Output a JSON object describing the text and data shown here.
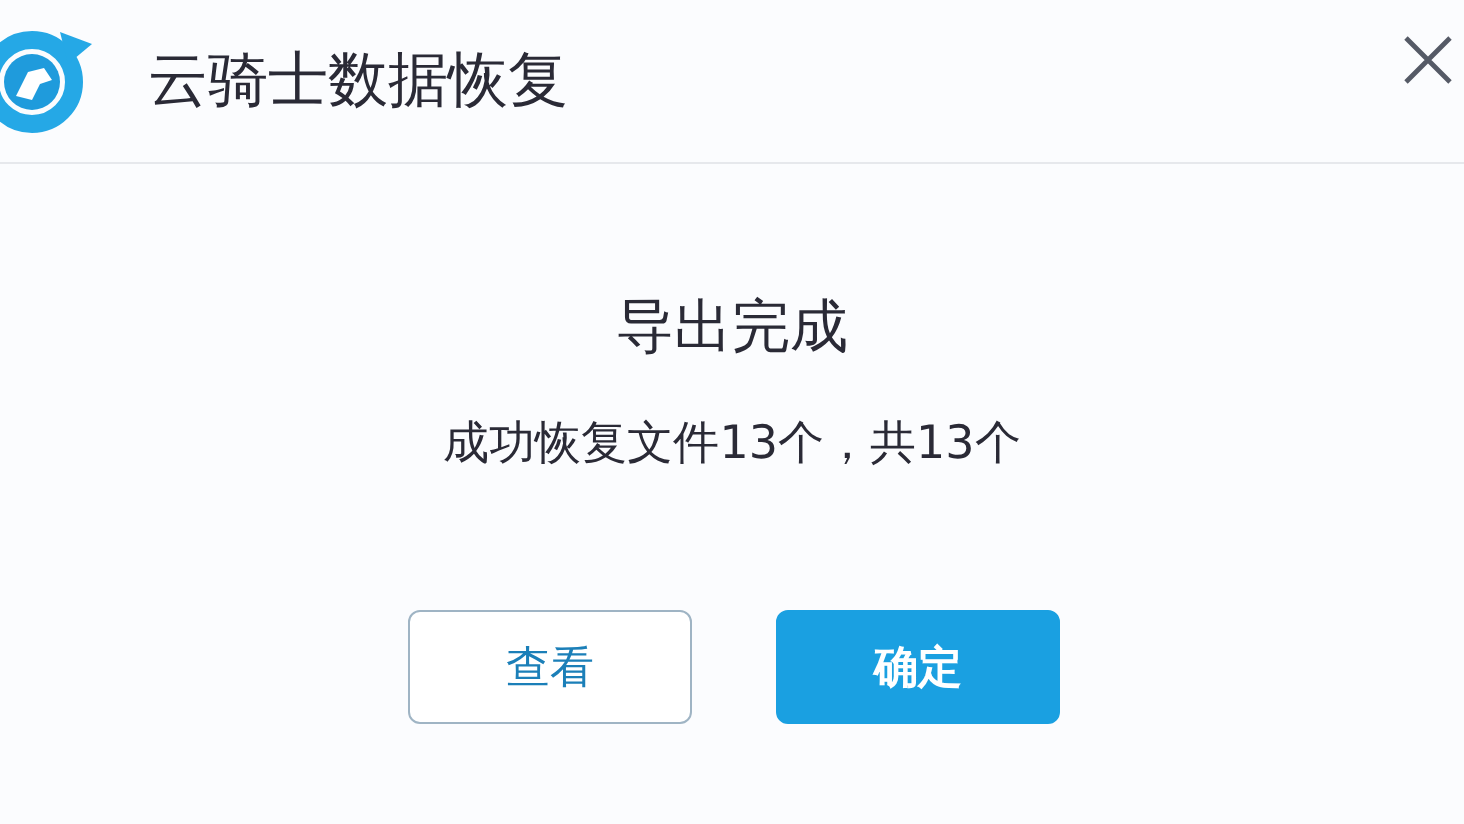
{
  "window": {
    "title": "云骑士数据恢复"
  },
  "message": {
    "heading": "导出完成",
    "detail": "成功恢复文件13个，共13个"
  },
  "buttons": [
    {
      "label": "查看",
      "kind": "secondary"
    },
    {
      "label": "确定",
      "kind": "primary"
    }
  ]
}
